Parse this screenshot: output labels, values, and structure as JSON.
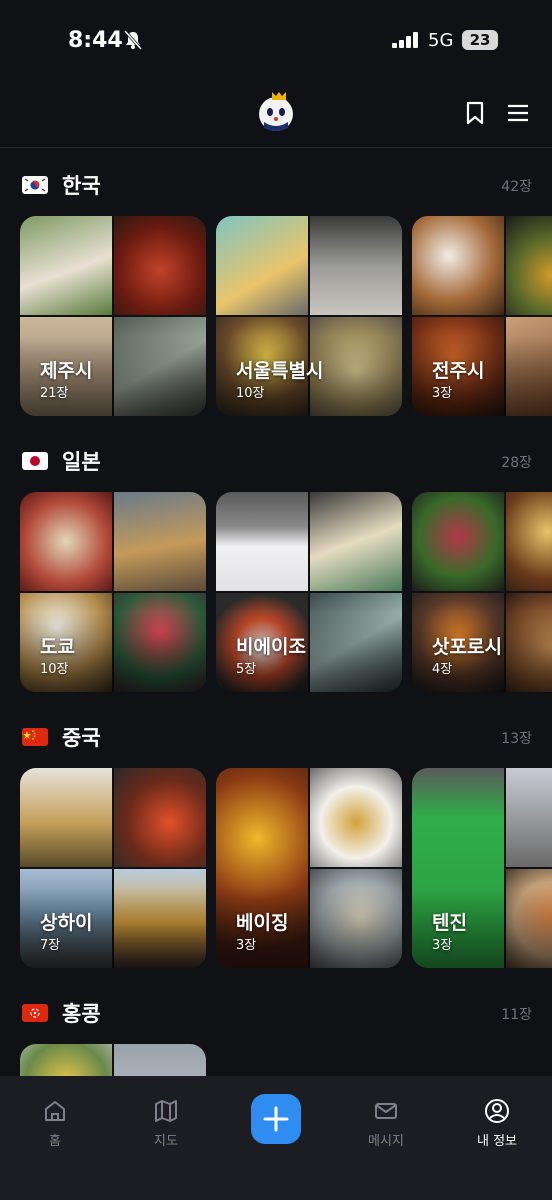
{
  "status": {
    "time": "8:44",
    "network": "5G",
    "battery": "23"
  },
  "header": {
    "logo_icon": "mascot-logo",
    "bookmark_icon": "bookmark-icon",
    "menu_icon": "menu-icon"
  },
  "sections": [
    {
      "flag": "kr",
      "title": "한국",
      "count": "42장",
      "cards": [
        {
          "title": "제주시",
          "count": "21장"
        },
        {
          "title": "서울특별시",
          "count": "10장"
        },
        {
          "title": "전주시",
          "count": "3장"
        }
      ]
    },
    {
      "flag": "jp",
      "title": "일본",
      "count": "28장",
      "cards": [
        {
          "title": "도쿄",
          "count": "10장"
        },
        {
          "title": "비에이조",
          "count": "5장"
        },
        {
          "title": "삿포로시",
          "count": "4장"
        }
      ]
    },
    {
      "flag": "cn",
      "title": "중국",
      "count": "13장",
      "cards": [
        {
          "title": "상하이",
          "count": "7장"
        },
        {
          "title": "베이징",
          "count": "3장"
        },
        {
          "title": "텐진",
          "count": "3장"
        }
      ]
    },
    {
      "flag": "hk",
      "title": "홍콩",
      "count": "11장",
      "cards": []
    }
  ],
  "tabbar": {
    "home": "홈",
    "map": "지도",
    "messages": "메시지",
    "profile": "내 정보"
  },
  "colors": {
    "background": "#101115",
    "accent": "#2f8cf0",
    "tabbar": "#1b1d22"
  }
}
